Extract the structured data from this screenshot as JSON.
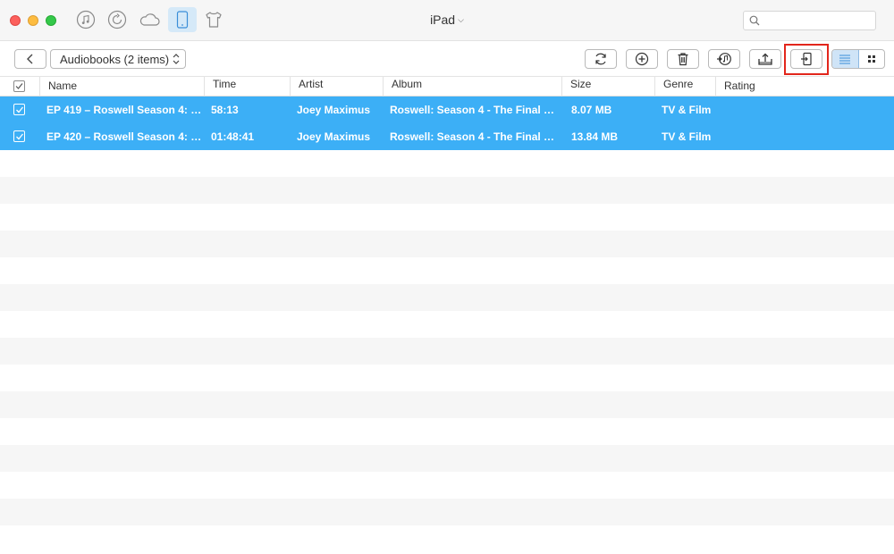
{
  "window": {
    "device_title": "iPad"
  },
  "titlebar_icons": [
    {
      "name": "music-note-icon"
    },
    {
      "name": "restore-icon"
    },
    {
      "name": "cloud-icon"
    },
    {
      "name": "device-icon",
      "active": true
    },
    {
      "name": "tshirt-icon"
    }
  ],
  "search": {
    "value": "",
    "placeholder": ""
  },
  "toolbar": {
    "category": "Audiobooks (2 items)",
    "actions": [
      {
        "name": "refresh-button",
        "icon": "refresh-icon"
      },
      {
        "name": "add-button",
        "icon": "plus-icon"
      },
      {
        "name": "delete-button",
        "icon": "trash-icon"
      },
      {
        "name": "to-itunes-button",
        "icon": "to-itunes-icon"
      },
      {
        "name": "to-computer-button",
        "icon": "export-icon"
      },
      {
        "name": "to-device-button",
        "icon": "send-to-device-icon",
        "highlighted": true
      }
    ],
    "view_modes": [
      {
        "name": "list-view-button",
        "icon": "list-icon",
        "active": true
      },
      {
        "name": "grid-view-button",
        "icon": "grid-icon",
        "active": false
      }
    ]
  },
  "table": {
    "columns": [
      "Name",
      "Time",
      "Artist",
      "Album",
      "Size",
      "Genre",
      "Rating"
    ],
    "rows": [
      {
        "selected": true,
        "name": "EP 419 – Roswell Season 4: T…",
        "time": "58:13",
        "artist": "Joey Maximus",
        "album": "Roswell: Season 4 - The Final Ch…",
        "size": "8.07 MB",
        "genre": "TV & Film",
        "rating": ""
      },
      {
        "selected": true,
        "name": "EP 420 – Roswell Season 4: T…",
        "time": "01:48:41",
        "artist": "Joey Maximus",
        "album": "Roswell: Season 4 - The Final Ch…",
        "size": "13.84 MB",
        "genre": "TV & Film",
        "rating": ""
      }
    ]
  },
  "colors": {
    "selection": "#3caff6",
    "highlight_box": "#e2261c",
    "stripe": "#f6f6f6"
  }
}
